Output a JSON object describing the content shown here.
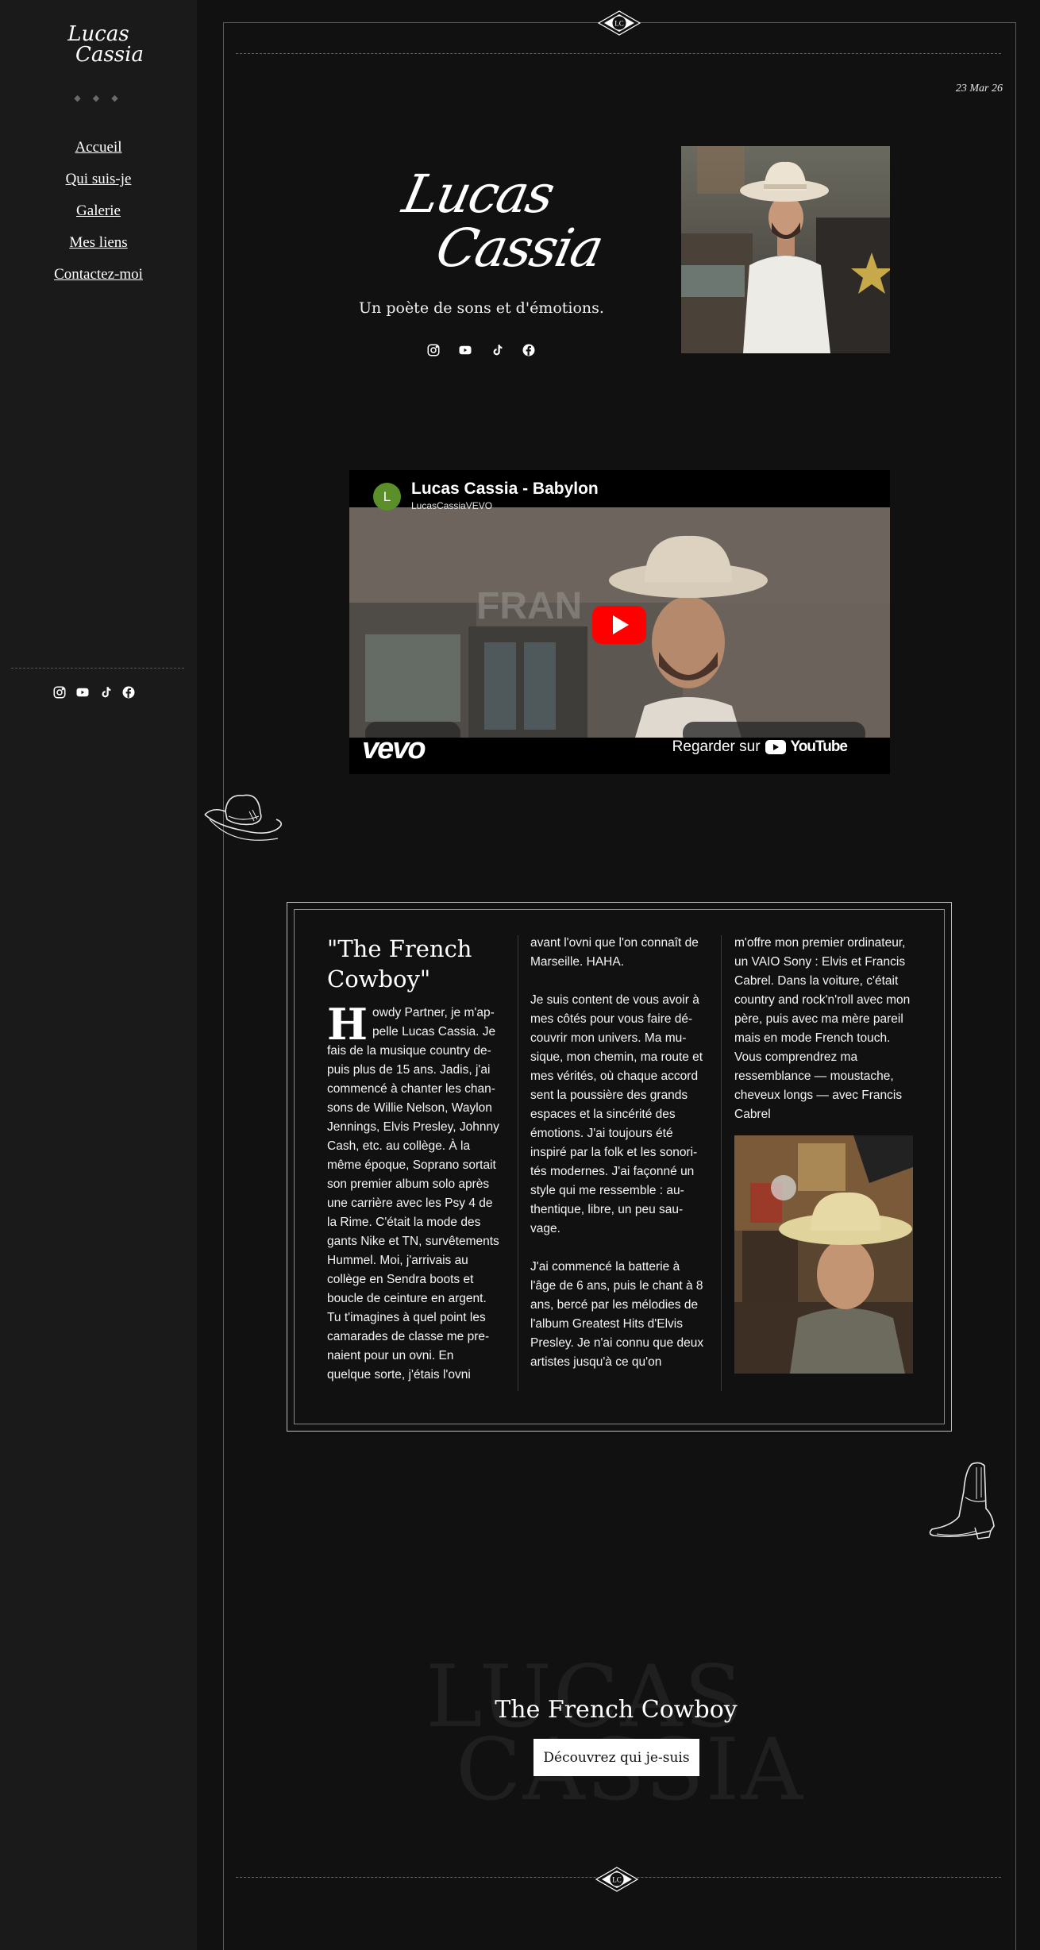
{
  "sidebar": {
    "logo_line1": "Lucas",
    "logo_line2": "Cassia",
    "diamonds": "◆ ◆ ◆",
    "nav": [
      {
        "label": "Accueil"
      },
      {
        "label": "Qui suis-je"
      },
      {
        "label": "Galerie"
      },
      {
        "label": "Mes liens"
      },
      {
        "label": "Contactez-moi"
      }
    ],
    "social": [
      "instagram-icon",
      "youtube-icon",
      "tiktok-icon",
      "facebook-icon"
    ]
  },
  "badge": {
    "text": "LC"
  },
  "header": {
    "date": "23 Mar 26"
  },
  "hero": {
    "logo_line1": "Lucas",
    "logo_line2": "Cassia",
    "tagline": "Un poète de sons et d'émotions."
  },
  "video": {
    "avatar_letter": "L",
    "title": "Lucas Cassia - Babylon",
    "channel": "LucasCassiaVEVO",
    "vevo": "vevo",
    "watch_label": "Regarder sur",
    "youtube_label": "YouTube"
  },
  "story": {
    "title": "\"The French Cowboy\"",
    "dropcap": "H",
    "col1_text": "owdy Partner, je m'ap­pelle Lucas Cassia. Je fais de la musique country de­puis plus de 15 ans. Jadis, j'ai commencé à chanter les chan­sons de Willie Nelson, Waylon Jennings, Elvis Presley, Johnny Cash, etc. au collège. À la même époque, Soprano sortait son premier album solo après une carrière avec les Psy 4 de la Rime. C'était la mode des gants Nike et TN, survête­ments Hummel. Moi, j'arrivais au collège en Sendra boots et boucle de ceinture en argent. Tu t'imagines à quel point les camarades de classe me pre­naient pour un ovni. En quelque sorte, j'étais l'ovni",
    "col2_p1": "avant l'ovni que l'on connaît de Marseille. HAHA.",
    "col2_p2": "Je suis content de vous avoir à mes côtés pour vous faire dé­couvrir mon univers. Ma mu­sique, mon chemin, ma route et mes vérités, où chaque ac­cord sent la poussière des grands espaces et la sincérité des émotions. J'ai toujours été inspiré par la folk et les sonori­tés modernes. J'ai façonné un style qui me ressemble : au­thentique, libre, un peu sau­vage.",
    "col2_p3": "J'ai commencé la batterie à l'âge de 6 ans, puis le chant à 8 ans, bercé par les mélodies de l'album Greatest Hits d'Elvis Presley. Je n'ai connu que deux artistes jusqu'à ce qu'on",
    "col3_text": "m'offre mon premier ordina­teur, un VAIO Sony : Elvis et Francis Cabrel. Dans la voiture, c'était country and rock'n'roll avec mon père, puis avec ma mère pareil mais en mode French touch. Vous compren­drez ma ressemblance — moustache, cheveux longs — avec Francis Cabrel"
  },
  "cta": {
    "bg_line1": "LUCAS",
    "bg_line2": "CASSIA",
    "title": "The French Cowboy",
    "button": "Découvrez qui je-suis"
  },
  "colors": {
    "background": "#111111",
    "sidebar": "#1a1a1a",
    "youtube_red": "#ff0000",
    "button_bg": "#ffffff"
  }
}
